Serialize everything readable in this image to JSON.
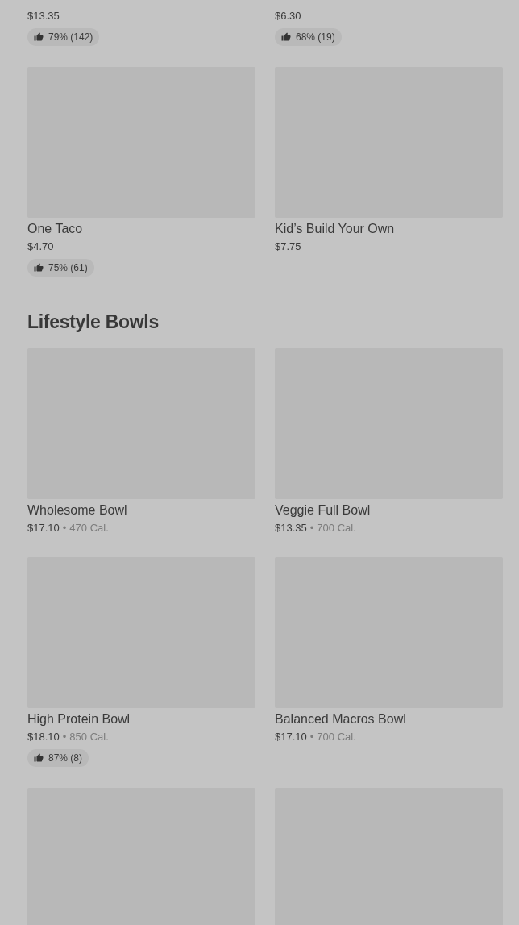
{
  "sections": [
    {
      "items": [
        {
          "price": "$13.35",
          "rating": "79% (142)"
        },
        {
          "price": "$6.30",
          "rating": "68% (19)"
        },
        {
          "picture": true,
          "name": "One Taco",
          "price": "$4.70",
          "rating": "75% (61)"
        },
        {
          "picture": true,
          "name": "Kid’s Build Your Own",
          "price": "$7.75"
        }
      ]
    },
    {
      "title": "Lifestyle Bowls",
      "items": [
        {
          "picture": true,
          "name": "Wholesome Bowl",
          "price": "$17.10",
          "separator": "•",
          "calories": "470 Cal."
        },
        {
          "picture": true,
          "name": "Veggie Full Bowl",
          "price": "$13.35",
          "separator": "•",
          "calories": "700 Cal."
        },
        {
          "picture": true,
          "name": "High Protein Bowl",
          "price": "$18.10",
          "separator": "•",
          "calories": "850 Cal.",
          "rating": "87% (8)"
        },
        {
          "picture": true,
          "name": "Balanced Macros Bowl",
          "price": "$17.10",
          "separator": "•",
          "calories": "700 Cal."
        },
        {
          "picture": true
        },
        {
          "picture": true
        }
      ]
    }
  ]
}
